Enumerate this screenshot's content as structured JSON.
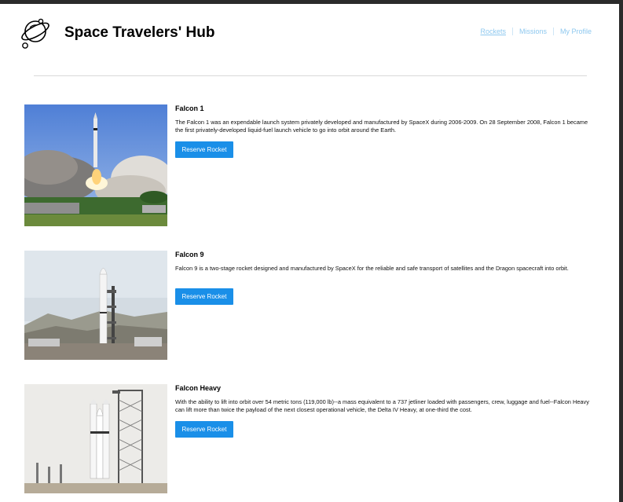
{
  "header": {
    "title": "Space Travelers' Hub",
    "nav": [
      "Rockets",
      "Missions",
      "My Profile"
    ]
  },
  "rockets": [
    {
      "name": "Falcon 1",
      "description": "The Falcon 1 was an expendable launch system privately developed and manufactured by SpaceX during 2006-2009. On 28 September 2008, Falcon 1 became the first privately-developed liquid-fuel launch vehicle to go into orbit around the Earth.",
      "button": "Reserve Rocket"
    },
    {
      "name": "Falcon 9",
      "description": "Falcon 9 is a two-stage rocket designed and manufactured by SpaceX for the reliable and safe transport of satellites and the Dragon spacecraft into orbit.",
      "button": "Reserve Rocket"
    },
    {
      "name": "Falcon Heavy",
      "description": "With the ability to lift into orbit over 54 metric tons (119,000 lb)--a mass equivalent to a 737 jetliner loaded with passengers, crew, luggage and fuel--Falcon Heavy can lift more than twice the payload of the next closest operational vehicle, the Delta IV Heavy, at one-third the cost.",
      "button": "Reserve Rocket"
    }
  ],
  "colors": {
    "accent": "#1a8fe8",
    "nav_link": "#8ec8ef",
    "frame": "#2b2b2b"
  }
}
